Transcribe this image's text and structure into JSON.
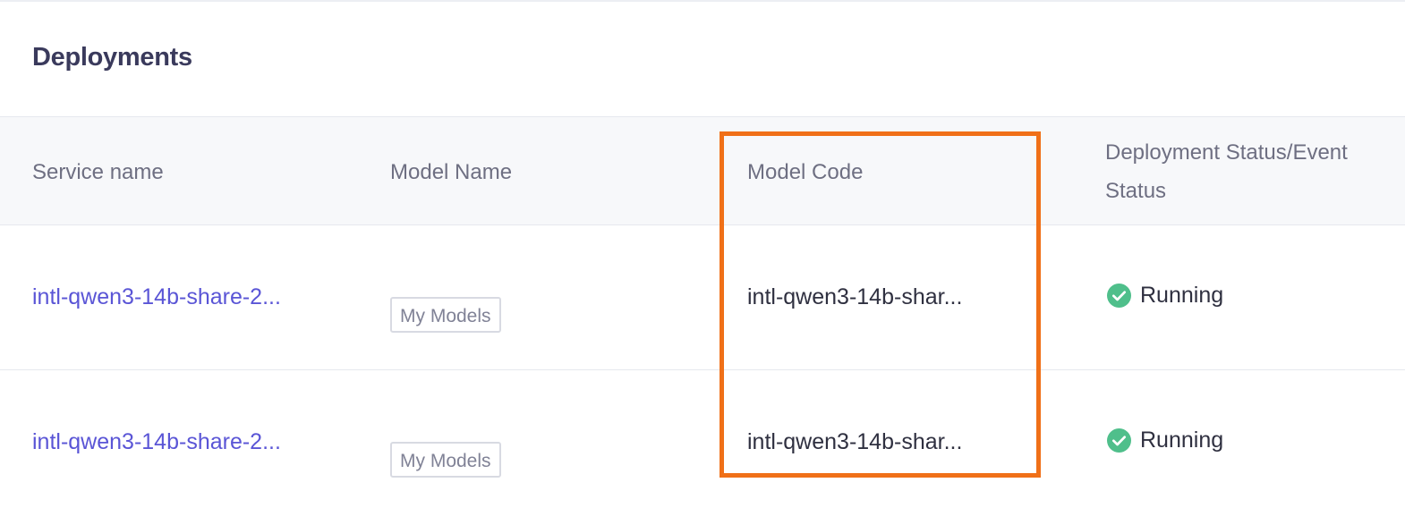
{
  "section": {
    "title": "Deployments"
  },
  "table": {
    "columns": [
      "Service name",
      "Model Name",
      "Model Code",
      "Deployment Status/Event Status"
    ],
    "rows": [
      {
        "service_name": "intl-qwen3-14b-share-2...",
        "model_name": "My Models",
        "model_code": "intl-qwen3-14b-shar...",
        "status": "Running"
      },
      {
        "service_name": "intl-qwen3-14b-share-2...",
        "model_name": "My Models",
        "model_code": "intl-qwen3-14b-shar...",
        "status": "Running"
      }
    ]
  },
  "icons": {
    "status": "check-circle-icon"
  },
  "colors": {
    "link": "#5a55d6",
    "status_ok": "#4fbf8b",
    "highlight": "#f07018",
    "header_bg": "#f7f8fa"
  }
}
